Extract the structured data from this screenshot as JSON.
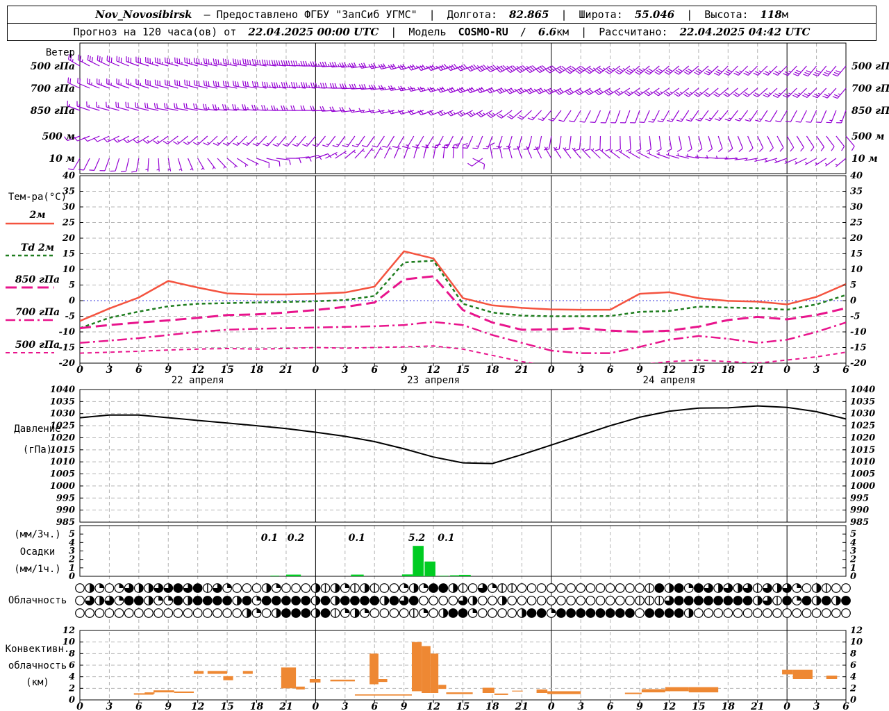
{
  "header": {
    "station": "Nov_Novosibirsk",
    "provided_by": "– Предоставлено ФГБУ \"ЗапСиб УГМС\"",
    "sep": "|",
    "slash": "/",
    "lon_label": "Долгота:",
    "lon": "82.865",
    "lat_label": "Широта:",
    "lat": "55.046",
    "alt_label": "Высота:",
    "alt": "118",
    "alt_unit": "м",
    "forecast_label": "Прогноз на 120 часа(ов) от",
    "run_time": "22.04.2025 00:00 UTC",
    "model_label": "Модель",
    "model": "COSMO-RU",
    "model_res": "6.6",
    "model_res_unit": "км",
    "calc_label": "Рассчитано:",
    "calc_time": "22.04.2025 04:42 UTC"
  },
  "colors": {
    "barb": "#9400d3",
    "t2m": "#f4533f",
    "td2m": "#1e7d1e",
    "magenta": "#e8148c",
    "zero_line": "#3333dd",
    "pressure": "#000000",
    "precip_bar": "#00cc22",
    "convective_bar": "#ee8833",
    "grid": "#b3b3b3"
  },
  "x_axis": {
    "span_hours": 78,
    "tick_step_hours": 3,
    "tick_labels": [
      "0",
      "3",
      "6",
      "9",
      "12",
      "15",
      "18",
      "21",
      "0",
      "3",
      "6",
      "9",
      "12",
      "15",
      "18",
      "21",
      "0",
      "3",
      "6",
      "9",
      "12",
      "15",
      "18",
      "21",
      "0",
      "3",
      "6"
    ],
    "day_boundary_hours": [
      24,
      48,
      72
    ],
    "date_labels": [
      {
        "text": "22 апреля",
        "hour": 12
      },
      {
        "text": "23 апреля",
        "hour": 36
      },
      {
        "text": "24 апреля",
        "hour": 60
      }
    ]
  },
  "panels": {
    "wind": {
      "title": "Ветер",
      "levels": [
        "500 гПа",
        "700 гПа",
        "850 гПа",
        "500 м",
        "10 м"
      ]
    },
    "temperature": {
      "title": "Тем-ра(°C)",
      "yticks": [
        40,
        35,
        30,
        25,
        20,
        15,
        10,
        5,
        0,
        -5,
        -10,
        -15,
        -20
      ],
      "legend": [
        {
          "label": "2м"
        },
        {
          "label": "Td 2м"
        },
        {
          "label": "850 гПа"
        },
        {
          "label": "700 гПа"
        },
        {
          "label": "500 гПа"
        }
      ]
    },
    "pressure": {
      "title": "Давление",
      "unit": "(гПа)",
      "yticks": [
        1040,
        1035,
        1030,
        1025,
        1020,
        1015,
        1010,
        1005,
        1000,
        995,
        990,
        985
      ]
    },
    "precipitation": {
      "title": "Осадки",
      "unit_3h": "(мм/3ч.)",
      "unit_1h": "(мм/1ч.)",
      "yticks": [
        5,
        4,
        3,
        2,
        1,
        0
      ]
    },
    "cloud": {
      "title": "Облачность"
    },
    "convective": {
      "title1": "Конвективн.",
      "title2": "облачность",
      "unit": "(км)",
      "yticks": [
        12,
        10,
        8,
        6,
        4,
        2,
        0
      ]
    }
  },
  "chart_data": [
    {
      "type": "wind-barbs",
      "title": "Ветер",
      "x_hours_step": 3,
      "levels": [
        {
          "name": "500 гПа",
          "dir": [
            300,
            295,
            290,
            285,
            285,
            280,
            280,
            275,
            270,
            265,
            260,
            255,
            250,
            250,
            245,
            240,
            240,
            235,
            235,
            230,
            230,
            230,
            225,
            225,
            225,
            220,
            220
          ],
          "speed_kt": [
            25,
            30,
            30,
            35,
            35,
            35,
            40,
            40,
            35,
            35,
            30,
            30,
            35,
            40,
            45,
            45,
            40,
            40,
            35,
            35,
            30,
            30,
            30,
            25,
            25,
            30,
            30
          ]
        },
        {
          "name": "700 гПа",
          "dir": [
            295,
            290,
            290,
            285,
            285,
            280,
            280,
            275,
            275,
            270,
            265,
            260,
            255,
            250,
            250,
            245,
            245,
            240,
            240,
            235,
            235,
            230,
            230,
            230,
            225,
            225,
            220
          ],
          "speed_kt": [
            20,
            25,
            25,
            30,
            30,
            30,
            30,
            35,
            35,
            30,
            30,
            25,
            25,
            30,
            30,
            35,
            35,
            30,
            30,
            25,
            25,
            25,
            20,
            20,
            25,
            25,
            25
          ]
        },
        {
          "name": "850 гПа",
          "dir": [
            290,
            285,
            285,
            280,
            280,
            275,
            275,
            270,
            270,
            265,
            260,
            255,
            250,
            245,
            240,
            230,
            220,
            210,
            200,
            200,
            210,
            215,
            220,
            215,
            210,
            205,
            200
          ],
          "speed_kt": [
            15,
            15,
            20,
            20,
            20,
            25,
            25,
            25,
            20,
            20,
            15,
            15,
            20,
            25,
            25,
            20,
            15,
            10,
            10,
            10,
            15,
            15,
            15,
            15,
            10,
            10,
            15
          ]
        },
        {
          "name": "500 м",
          "dir": [
            250,
            245,
            240,
            235,
            230,
            225,
            225,
            220,
            220,
            215,
            215,
            210,
            210,
            205,
            200,
            195,
            190,
            185,
            180,
            175,
            170,
            165,
            160,
            155,
            150,
            145,
            140
          ],
          "speed_kt": [
            12,
            12,
            14,
            14,
            15,
            15,
            16,
            16,
            15,
            14,
            12,
            12,
            14,
            15,
            15,
            12,
            10,
            8,
            8,
            10,
            10,
            10,
            10,
            8,
            8,
            8,
            10
          ]
        },
        {
          "name": "10 м",
          "dir": [
            210,
            200,
            190,
            170,
            150,
            130,
            110,
            90,
            70,
            50,
            30,
            20,
            10,
            0,
            350,
            340,
            330,
            320,
            310,
            300,
            290,
            280,
            270,
            260,
            250,
            240,
            230
          ],
          "speed_kt": [
            8,
            8,
            8,
            6,
            6,
            6,
            8,
            8,
            8,
            6,
            6,
            6,
            8,
            8,
            8,
            6,
            6,
            5,
            5,
            5,
            6,
            6,
            6,
            5,
            5,
            5,
            6
          ]
        }
      ]
    },
    {
      "type": "line",
      "title": "Тем-ра(°C)",
      "ylabel": "°C",
      "ylim": [
        -20,
        40
      ],
      "x_hours_step": 3,
      "series": [
        {
          "name": "2м",
          "style": "solid",
          "color": "#f4533f",
          "values": [
            -6.5,
            -2.5,
            1.0,
            6.3,
            4.2,
            2.3,
            2.0,
            2.0,
            2.2,
            2.6,
            4.5,
            15.8,
            13.5,
            0.8,
            -1.5,
            -2.3,
            -2.8,
            -2.9,
            -2.9,
            2.2,
            2.7,
            0.8,
            -0.1,
            -0.3,
            -1.2,
            1.2,
            5.3
          ]
        },
        {
          "name": "Td 2м",
          "style": "dashed",
          "color": "#1e7d1e",
          "values": [
            -8.8,
            -5.5,
            -3.5,
            -1.8,
            -1.0,
            -0.8,
            -0.6,
            -0.4,
            -0.2,
            0.2,
            1.5,
            12.2,
            12.8,
            -1.0,
            -3.8,
            -4.8,
            -5.0,
            -5.0,
            -4.9,
            -3.6,
            -3.3,
            -1.9,
            -2.2,
            -2.4,
            -2.9,
            -1.2,
            1.8
          ]
        },
        {
          "name": "850 гПа",
          "style": "long-dash",
          "color": "#e8148c",
          "values": [
            -8.8,
            -7.8,
            -7.0,
            -6.3,
            -5.5,
            -4.6,
            -4.4,
            -3.8,
            -3.0,
            -2.0,
            -0.6,
            6.8,
            7.8,
            -3.0,
            -7.0,
            -9.3,
            -9.2,
            -8.8,
            -9.6,
            -10.0,
            -9.6,
            -8.3,
            -6.2,
            -5.2,
            -6.0,
            -4.6,
            -2.4
          ]
        },
        {
          "name": "700 гПа",
          "style": "dash-dot",
          "color": "#e8148c",
          "values": [
            -13.5,
            -12.8,
            -12.0,
            -11.0,
            -10.0,
            -9.3,
            -9.0,
            -8.8,
            -8.6,
            -8.4,
            -8.2,
            -7.8,
            -6.8,
            -7.8,
            -11.0,
            -13.5,
            -16.0,
            -16.8,
            -16.8,
            -14.8,
            -12.5,
            -11.3,
            -12.2,
            -13.5,
            -12.5,
            -10.0,
            -7.0
          ]
        },
        {
          "name": "500 гПа",
          "style": "short-dash",
          "color": "#e8148c",
          "values": [
            -16.8,
            -16.5,
            -16.2,
            -15.8,
            -15.5,
            -15.3,
            -15.5,
            -15.3,
            -15.0,
            -15.2,
            -15.0,
            -14.8,
            -14.5,
            -15.5,
            -17.5,
            -19.5,
            -21.0,
            -21.5,
            -21.0,
            -20.5,
            -19.5,
            -19.0,
            -19.5,
            -20.0,
            -19.0,
            -18.0,
            -16.5
          ]
        }
      ]
    },
    {
      "type": "line",
      "title": "Давление (гПа)",
      "ylim": [
        985,
        1040
      ],
      "x_hours_step": 3,
      "series": [
        {
          "name": "Давление",
          "style": "solid",
          "color": "#000000",
          "values": [
            1028.3,
            1029.4,
            1029.4,
            1028.3,
            1027.2,
            1026.1,
            1025.0,
            1023.8,
            1022.3,
            1020.6,
            1018.4,
            1015.4,
            1012.0,
            1009.6,
            1009.3,
            1013.0,
            1017.0,
            1021.0,
            1025.0,
            1028.5,
            1031.0,
            1032.3,
            1032.4,
            1033.2,
            1032.6,
            1030.8,
            1027.8
          ]
        }
      ]
    },
    {
      "type": "bar",
      "title": "Осадки (мм/1ч.)",
      "ylim": [
        0,
        6
      ],
      "bars": [
        {
          "start_hour": 19.4,
          "width_hours": 0.9,
          "value": 0.08
        },
        {
          "start_hour": 21.0,
          "width_hours": 1.5,
          "value": 0.2
        },
        {
          "start_hour": 27.6,
          "width_hours": 1.3,
          "value": 0.2
        },
        {
          "start_hour": 32.8,
          "width_hours": 1.1,
          "value": 0.22
        },
        {
          "start_hour": 33.9,
          "width_hours": 1.1,
          "value": 3.6
        },
        {
          "start_hour": 35.1,
          "width_hours": 1.1,
          "value": 1.75
        },
        {
          "start_hour": 36.6,
          "width_hours": 0.9,
          "value": 0.07
        },
        {
          "start_hour": 37.7,
          "width_hours": 0.9,
          "value": 0.12
        },
        {
          "start_hour": 38.6,
          "width_hours": 1.2,
          "value": 0.17
        }
      ],
      "labels_3h": [
        {
          "hour": 19.3,
          "text": "0.1"
        },
        {
          "hour": 22.0,
          "text": "0.2"
        },
        {
          "hour": 28.2,
          "text": "0.1"
        },
        {
          "hour": 34.3,
          "text": "5.2"
        },
        {
          "hour": 37.3,
          "text": "0.1"
        }
      ]
    },
    {
      "type": "heatmap",
      "title": "Облачность",
      "legend_note": "octas per hour, 0=clear 1=quarter 2=half 3=three-quarter 4=overcast 5=vertical-bar",
      "rows": [
        "0210132233434531000210002521525001214425031550000000000000542414323235323102500",
        "0323144211424444241444442424444243400003200200000000000005553444444442354142424",
        "0000000000000000021024442451210000510244100002441444444440444420000000000000000"
      ]
    },
    {
      "type": "gantt",
      "title": "Конвективн. облачность (км)",
      "ylim": [
        0,
        12
      ],
      "segments_h0_h1_base_top": [
        [
          5.5,
          7.5,
          0.9,
          1.15
        ],
        [
          6.6,
          7.6,
          1.05,
          1.3
        ],
        [
          7.5,
          9.6,
          1.3,
          1.65
        ],
        [
          9.6,
          11.6,
          1.2,
          1.45
        ],
        [
          11.6,
          12.6,
          4.5,
          5.0
        ],
        [
          13.0,
          15.0,
          4.5,
          5.0
        ],
        [
          14.6,
          15.6,
          3.4,
          4.1
        ],
        [
          16.6,
          17.6,
          4.5,
          5.0
        ],
        [
          20.5,
          22.0,
          2.0,
          5.6
        ],
        [
          22.0,
          22.9,
          1.8,
          2.3
        ],
        [
          23.4,
          24.5,
          3.0,
          3.6
        ],
        [
          25.5,
          28.0,
          3.2,
          3.5
        ],
        [
          28.0,
          33.8,
          0.75,
          0.95
        ],
        [
          29.5,
          30.4,
          2.7,
          8.0
        ],
        [
          30.4,
          31.3,
          3.1,
          3.6
        ],
        [
          33.8,
          34.8,
          1.5,
          10.0
        ],
        [
          34.8,
          35.7,
          1.2,
          9.3
        ],
        [
          35.7,
          36.5,
          1.2,
          8.0
        ],
        [
          36.5,
          37.3,
          1.9,
          2.6
        ],
        [
          37.3,
          40.0,
          1.0,
          1.3
        ],
        [
          41.0,
          42.2,
          1.2,
          2.1
        ],
        [
          42.2,
          43.6,
          0.85,
          1.1
        ],
        [
          44.0,
          45.1,
          1.45,
          1.6
        ],
        [
          46.5,
          47.6,
          1.2,
          1.8
        ],
        [
          47.6,
          51.0,
          1.0,
          1.5
        ],
        [
          55.5,
          57.2,
          1.0,
          1.25
        ],
        [
          57.2,
          59.6,
          1.3,
          1.85
        ],
        [
          59.6,
          62.0,
          1.5,
          2.2
        ],
        [
          62.0,
          65.0,
          1.3,
          2.2
        ],
        [
          71.5,
          72.6,
          4.4,
          5.2
        ],
        [
          72.6,
          74.6,
          3.6,
          5.2
        ],
        [
          76.0,
          77.1,
          3.6,
          4.2
        ]
      ]
    }
  ]
}
